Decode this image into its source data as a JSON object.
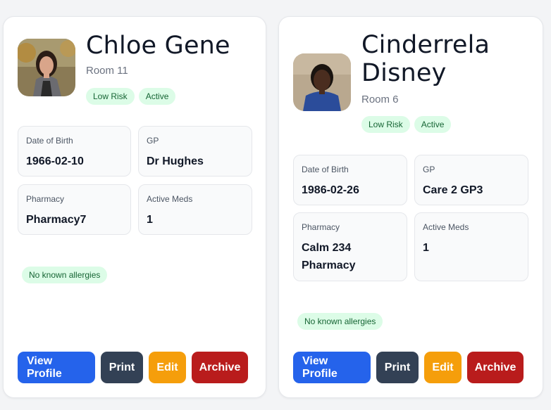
{
  "residents": [
    {
      "name": "Chloe Gene",
      "room": "Room 11",
      "badges": [
        "Low Risk",
        "Active"
      ],
      "details": {
        "dob_label": "Date of Birth",
        "dob": "1966-02-10",
        "gp_label": "GP",
        "gp": "Dr Hughes",
        "pharmacy_label": "Pharmacy",
        "pharmacy": "Pharmacy7",
        "meds_label": "Active Meds",
        "meds": "1"
      },
      "allergy": "No known allergies",
      "actions": {
        "view": "View Profile",
        "print": "Print",
        "edit": "Edit",
        "archive": "Archive"
      }
    },
    {
      "name_line1": "Cinderrela",
      "name_line2": "Disney",
      "room": "Room 6",
      "badges": [
        "Low Risk",
        "Active"
      ],
      "details": {
        "dob_label": "Date of Birth",
        "dob": "1986-02-26",
        "gp_label": "GP",
        "gp": "Care 2 GP3",
        "pharmacy_label": "Pharmacy",
        "pharmacy_line1": "Calm 234",
        "pharmacy_line2": "Pharmacy",
        "meds_label": "Active Meds",
        "meds": "1"
      },
      "allergy": "No known allergies",
      "actions": {
        "view": "View Profile",
        "print": "Print",
        "edit": "Edit",
        "archive": "Archive"
      }
    }
  ],
  "colors": {
    "primary": "#2563eb",
    "dark": "#334155",
    "warning": "#f59e0b",
    "danger": "#b91c1c",
    "badge_bg": "#dcfce7",
    "badge_text": "#166534"
  }
}
